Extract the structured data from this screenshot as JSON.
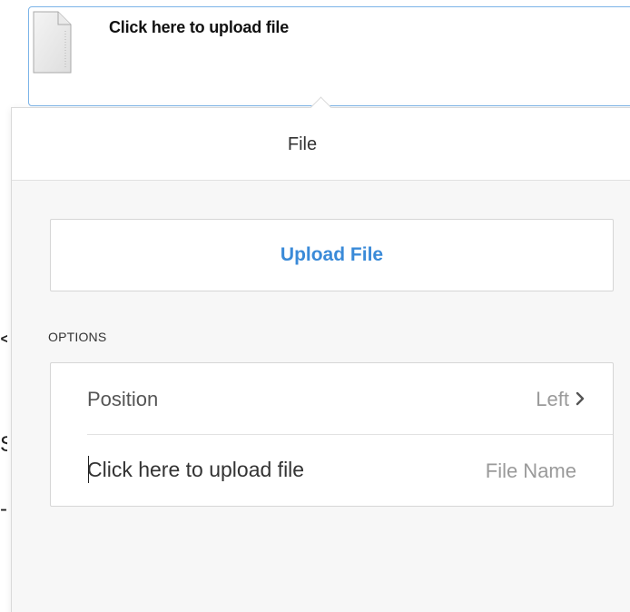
{
  "canvas": {
    "file_element": {
      "label": "Click here to upload file",
      "icon": "document-icon"
    },
    "edge_glyphs": [
      "<",
      "S",
      "-"
    ]
  },
  "popover": {
    "title": "File",
    "upload_button_label": "Upload File",
    "options_section_label": "OPTIONS",
    "options": {
      "position": {
        "label": "Position",
        "value": "Left",
        "icon": "chevron-right-icon"
      },
      "file_name": {
        "value": "Click here to upload file",
        "label": "File Name"
      }
    }
  },
  "colors": {
    "accent": "#3a8ad8",
    "selection_border": "#7cb4e8",
    "panel_background": "#f7f7f7"
  }
}
